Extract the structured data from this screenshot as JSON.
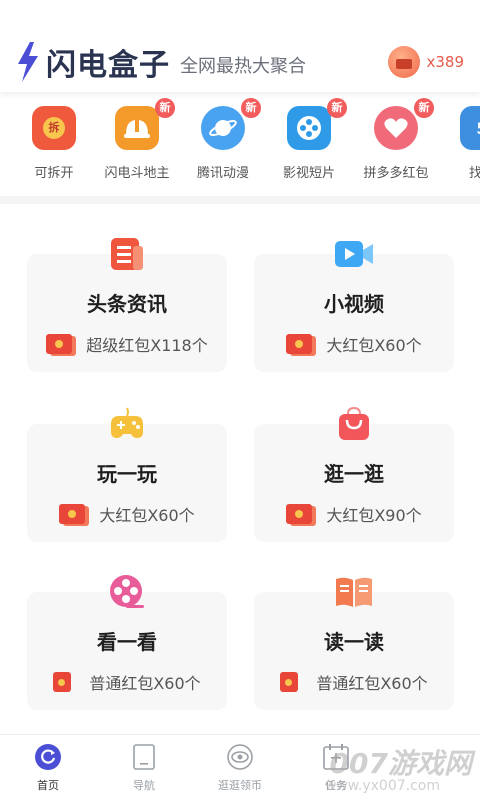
{
  "header": {
    "brand": "闪电盒子",
    "slogan": "全网最热大聚合",
    "coin_count": "x389"
  },
  "shortcuts": [
    {
      "label": "可拆开",
      "icon": "red-packet-icon",
      "icon_text": "拆",
      "new": false,
      "color": "#f05a3c"
    },
    {
      "label": "闪电斗地主",
      "icon": "helmet-icon",
      "icon_text": "",
      "new": true,
      "new_label": "新",
      "color": "#f39a2b"
    },
    {
      "label": "腾讯动漫",
      "icon": "planet-icon",
      "icon_text": "",
      "new": true,
      "new_label": "新",
      "color": "#4aa3f0"
    },
    {
      "label": "影视短片",
      "icon": "film-reel-icon",
      "icon_text": "",
      "new": true,
      "new_label": "新",
      "color": "#2f9be8"
    },
    {
      "label": "拼多多红包",
      "icon": "gift-heart-icon",
      "icon_text": "",
      "new": true,
      "new_label": "新",
      "color": "#f06a7a"
    },
    {
      "label": "找工",
      "icon": "calendar-icon",
      "icon_text": "5",
      "new": false,
      "color": "#3f8fe0"
    }
  ],
  "cards": [
    {
      "title": "头条资讯",
      "reward": "超级红包X118个",
      "icon": "news-icon",
      "color": "#f0563e"
    },
    {
      "title": "小视频",
      "reward": "大红包X60个",
      "icon": "video-play-icon",
      "color": "#3ea8f5"
    },
    {
      "title": "玩一玩",
      "reward": "大红包X60个",
      "icon": "gamepad-icon",
      "color": "#f6c13a"
    },
    {
      "title": "逛一逛",
      "reward": "大红包X90个",
      "icon": "shopping-bag-icon",
      "color": "#f2565a"
    },
    {
      "title": "看一看",
      "reward": "普通红包X60个",
      "icon": "film-reel-icon",
      "color": "#e85c9a"
    },
    {
      "title": "读一读",
      "reward": "普通红包X60个",
      "icon": "open-book-icon",
      "color": "#f27a4e"
    }
  ],
  "bottom_nav": [
    {
      "label": "首页",
      "icon": "refresh-circle-icon",
      "active": true
    },
    {
      "label": "导航",
      "icon": "tablet-icon",
      "active": false
    },
    {
      "label": "逛逛领币",
      "icon": "eye-icon",
      "active": false
    },
    {
      "label": "任务",
      "icon": "calendar-plus-icon",
      "active": false
    }
  ],
  "watermark": {
    "text": "007游戏网",
    "url": "www.yx007.com"
  },
  "colors": {
    "accent": "#4a4fd6",
    "brand_text": "#2a3350",
    "red": "#e9463a"
  }
}
